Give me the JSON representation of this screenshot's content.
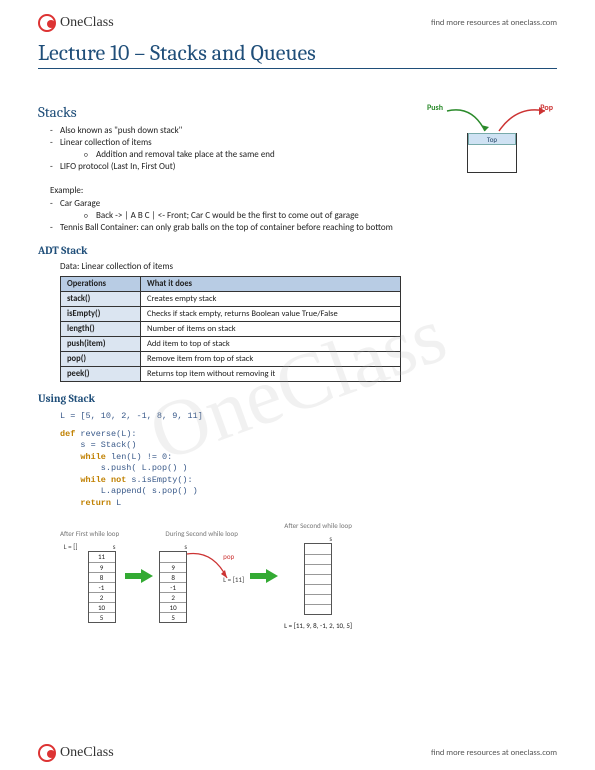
{
  "brand": "OneClass",
  "header_link": "find more resources at oneclass.com",
  "footer_link": "find more resources at oneclass.com",
  "watermark": "OneClass",
  "title": "Lecture 10 – Stacks and Queues",
  "sections": {
    "stacks": {
      "heading": "Stacks",
      "bullets": [
        "Also known as \"push down stack\"",
        "Linear collection of items",
        "LIFO protocol (Last In, First Out)"
      ],
      "sub_bullet": "Addition and removal take place at the same end",
      "diagram": {
        "push": "Push",
        "pop": "Pop",
        "top": "Top"
      },
      "example_label": "Example:",
      "example_bullets": [
        "Car Garage",
        "Tennis Ball Container: can only grab balls on the top of container before reaching to bottom"
      ],
      "example_sub": "Back -> | A B C | <- Front; Car C would be the first to come out of garage"
    },
    "adt": {
      "heading": "ADT Stack",
      "data_label": "Data: Linear collection of items",
      "table": {
        "headers": [
          "Operations",
          "What it does"
        ],
        "rows": [
          [
            "stack()",
            "Creates empty stack"
          ],
          [
            "isEmpty()",
            "Checks if stack empty, returns Boolean value True/False"
          ],
          [
            "length()",
            "Number of items on stack"
          ],
          [
            "push(item)",
            "Add item to top of stack"
          ],
          [
            "pop()",
            "Remove item from top of stack"
          ],
          [
            "peek()",
            "Returns top item without removing it"
          ]
        ]
      }
    },
    "using": {
      "heading": "Using Stack",
      "code_line1": "L = [5, 10, 2, -1, 8, 9, 11]",
      "code_lines": [
        "def reverse(L):",
        "    s = Stack()",
        "    while len(L) != 0:",
        "        s.push( L.pop() )",
        "    while not s.isEmpty():",
        "        L.append( s.pop() )",
        "    return L"
      ],
      "loop": {
        "col1": {
          "title": "After First while loop",
          "L": "L = []",
          "stack": [
            "11",
            "9",
            "8",
            "-1",
            "2",
            "10",
            "5"
          ]
        },
        "col2": {
          "title": "During Second while loop",
          "pop": "pop",
          "L_after": "L = [11]",
          "stack": [
            "",
            "9",
            "8",
            "-1",
            "2",
            "10",
            "5"
          ]
        },
        "col3": {
          "title": "After Second while loop",
          "stack": [
            "",
            "",
            "",
            "",
            "",
            "",
            ""
          ],
          "result": "L = [11, 9, 8, -1, 2, 10, 5]"
        },
        "s_label": "s"
      }
    }
  }
}
